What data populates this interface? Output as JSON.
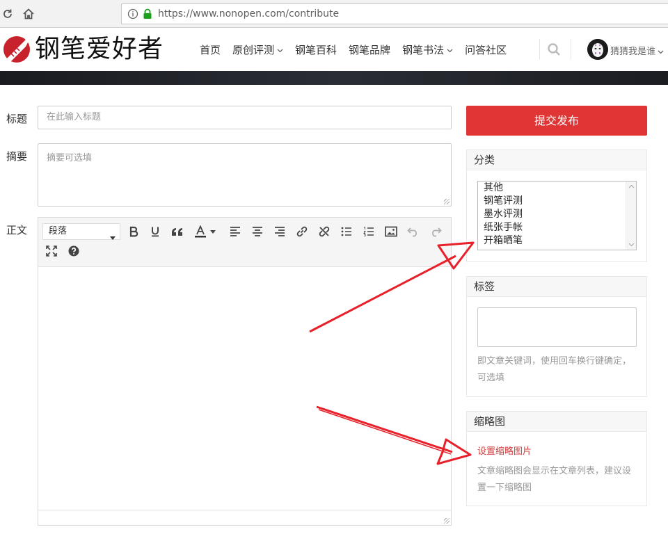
{
  "browser": {
    "url": "https://www.nonopen.com/contribute"
  },
  "header": {
    "logo_text": "钢笔爱好者",
    "nav": [
      {
        "label": "首页",
        "has_menu": false
      },
      {
        "label": "原创评测",
        "has_menu": true
      },
      {
        "label": "钢笔百科",
        "has_menu": false
      },
      {
        "label": "钢笔品牌",
        "has_menu": false
      },
      {
        "label": "钢笔书法",
        "has_menu": true
      },
      {
        "label": "问答社区",
        "has_menu": false
      }
    ],
    "username": "猜猜我是谁"
  },
  "form": {
    "title_label": "标题",
    "title_placeholder": "在此输入标题",
    "summary_label": "摘要",
    "summary_placeholder": "摘要可选填",
    "body_label": "正文",
    "editor": {
      "format_select": "段落"
    }
  },
  "sidebar": {
    "submit_label": "提交发布",
    "category": {
      "title": "分类",
      "options": [
        "其他",
        "钢笔评测",
        "墨水评测",
        "纸张手帐",
        "开箱晒笔"
      ]
    },
    "tags": {
      "title": "标签",
      "hint": "即文章关键词，使用回车换行键确定，可选填"
    },
    "thumbnail": {
      "title": "缩略图",
      "link": "设置缩略图片",
      "hint": "文章缩略图会显示在文章列表，建议设置一下缩略图"
    }
  },
  "colors": {
    "accent": "#e03535",
    "annotation_arrow": "#e8202a"
  }
}
